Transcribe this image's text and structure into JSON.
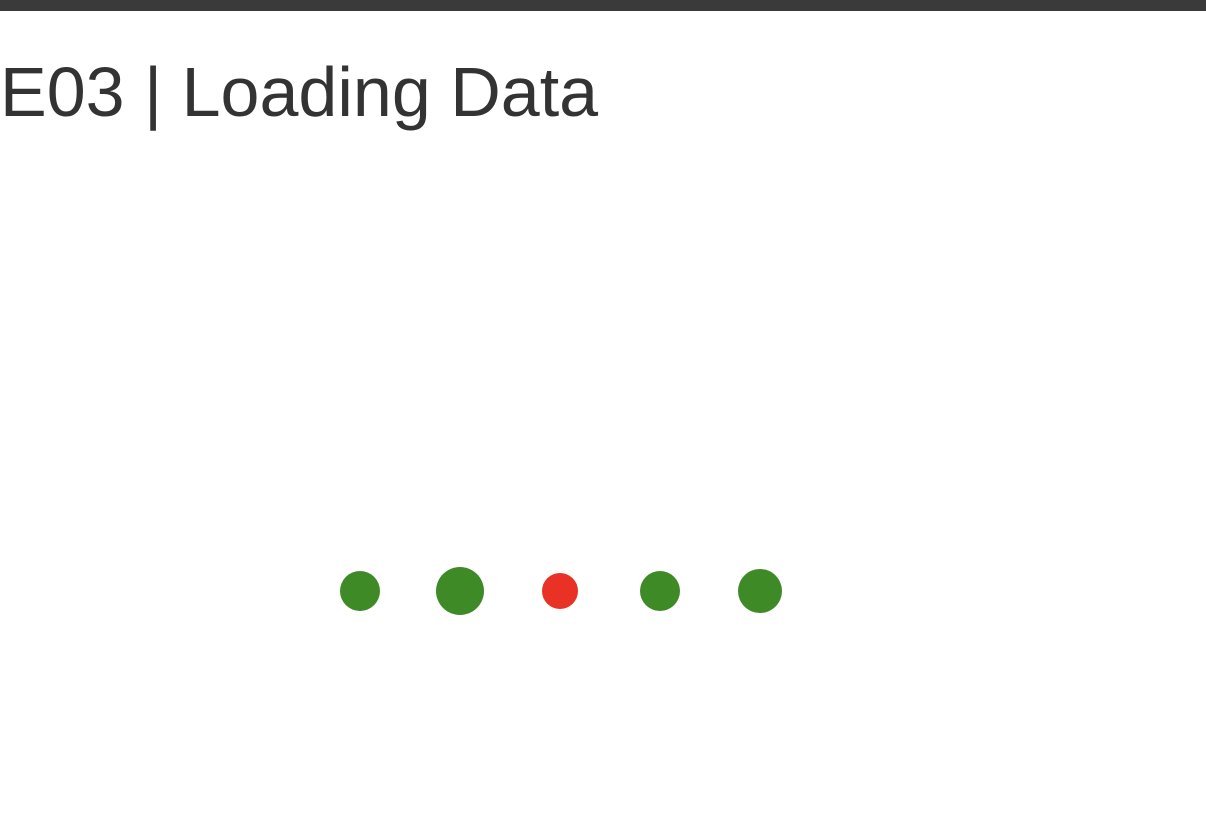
{
  "header": {
    "bar_color": "#3a3a3a"
  },
  "page": {
    "title": "E03 | Loading Data"
  },
  "loader": {
    "dots": [
      {
        "color": "#3e8a27"
      },
      {
        "color": "#3e8a27"
      },
      {
        "color": "#ea3126"
      },
      {
        "color": "#3e8a27"
      },
      {
        "color": "#3e8a27"
      }
    ]
  }
}
